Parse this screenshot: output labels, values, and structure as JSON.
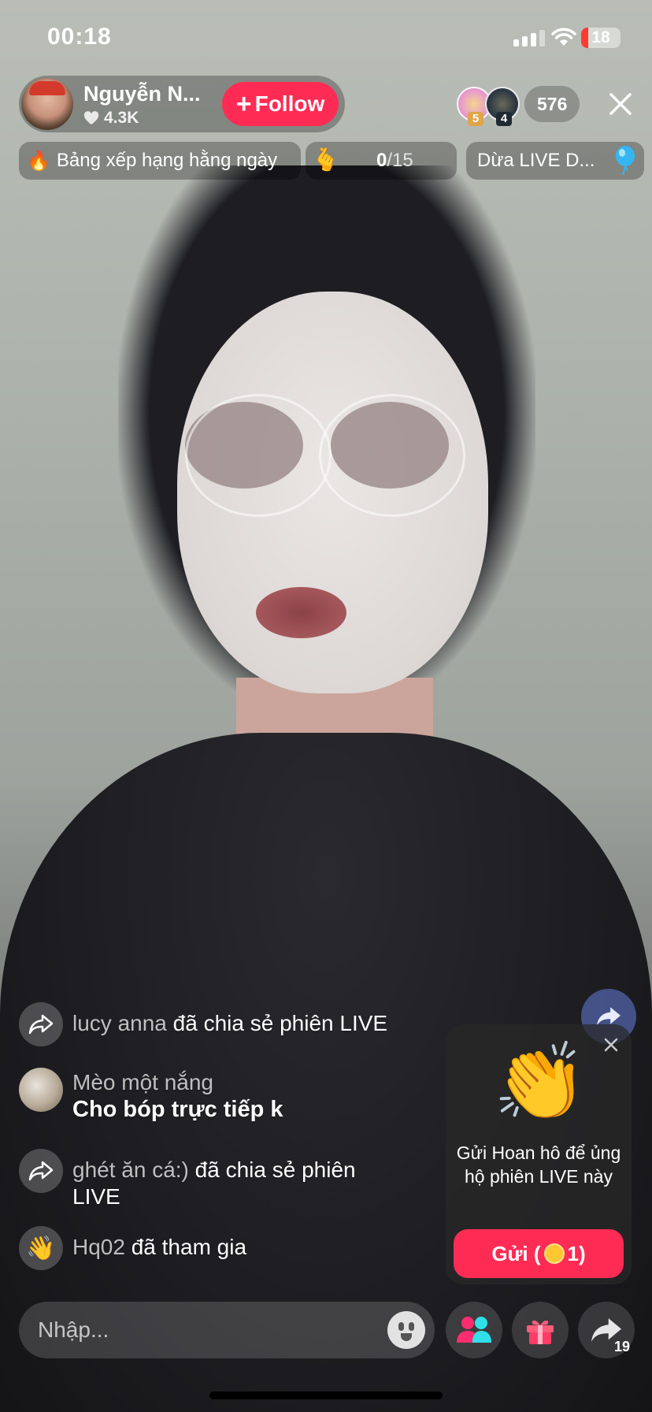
{
  "status_bar": {
    "time": "00:18",
    "battery": "18"
  },
  "host": {
    "name": "Nguyễn N...",
    "likes": "4.3K",
    "follow_label": "Follow"
  },
  "viewers": {
    "top1_rank": "5",
    "top2_rank": "4",
    "count": "576"
  },
  "chips": {
    "daily_ranking": "Bảng xếp hạng hằng ngày",
    "goal_current": "0",
    "goal_total": "/15",
    "live_title": "Dừa LIVE D..."
  },
  "comments": [
    {
      "user": "lucy anna",
      "text": "đã chia sẻ phiên LIVE",
      "icon": "share-icon"
    },
    {
      "user": "Mèo một nắng",
      "text": "Cho bóp trực tiếp k",
      "icon": "avatar"
    },
    {
      "user": "ghét ăn cá:)",
      "text": "đã chia sẻ phiên LIVE",
      "icon": "share-icon"
    },
    {
      "user": "Hq02",
      "text": "đã tham gia",
      "icon": "wave-icon"
    }
  ],
  "gift_popup": {
    "message": "Gửi Hoan hô để ủng hộ phiên LIVE này",
    "button_prefix": "Gửi (",
    "button_count": "1)"
  },
  "input": {
    "placeholder": "Nhập..."
  },
  "share": {
    "count": "19"
  },
  "colors": {
    "accent": "#fe2c55",
    "coin": "#ffc832"
  }
}
